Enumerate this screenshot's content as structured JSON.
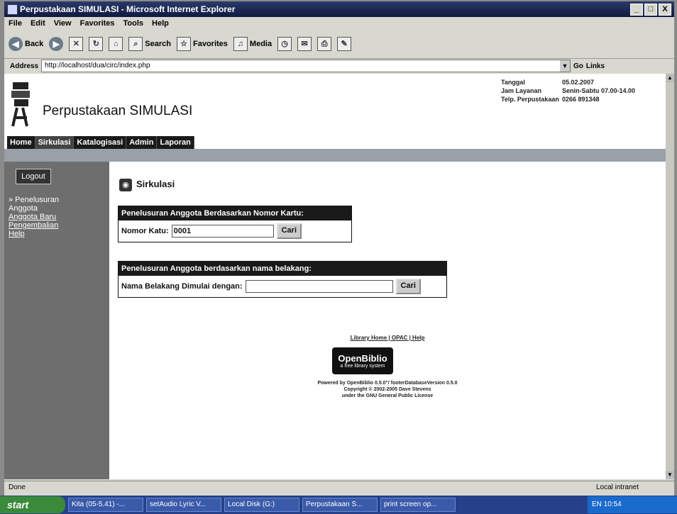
{
  "window": {
    "title": "Perpustakaan SIMULASI - Microsoft Internet Explorer",
    "buttons": [
      "_",
      "□",
      "X"
    ]
  },
  "menubar": [
    "File",
    "Edit",
    "View",
    "Favorites",
    "Tools",
    "Help"
  ],
  "toolbar": {
    "back": "Back",
    "search": "Search",
    "favorites": "Favorites",
    "media": "Media"
  },
  "address": {
    "label": "Address",
    "url": "http://localhost/dua/circ/index.php",
    "go": "Go",
    "links": "Links"
  },
  "header": {
    "site_title": "Perpustakaan SIMULASI",
    "info": [
      {
        "k": "Tanggal",
        "v": "05.02.2007"
      },
      {
        "k": "Jam Layanan",
        "v": "Senin-Sabtu 07.00-14.00"
      },
      {
        "k": "Telp. Perpustakaan",
        "v": "0266 891348"
      }
    ]
  },
  "tabs": [
    {
      "label": "Home"
    },
    {
      "label": "Sirkulasi"
    },
    {
      "label": "Katalogisasi"
    },
    {
      "label": "Admin"
    },
    {
      "label": "Laporan"
    }
  ],
  "sidebar": {
    "logout": "Logout",
    "items": [
      "» Penelusuran Anggota",
      "Anggota Baru",
      "Pengembalian",
      "Help"
    ]
  },
  "main": {
    "title": "Sirkulasi",
    "card_search": {
      "header": "Penelusuran Anggota Berdasarkan Nomor Kartu:",
      "label": "Nomor Katu:",
      "value": "0001",
      "button": "Cari"
    },
    "name_search": {
      "header": "Penelusuran Anggota berdasarkan nama belakang:",
      "label": "Nama Belakang Dimulai dengan:",
      "value": "",
      "button": "Cari"
    }
  },
  "footer": {
    "links": "Library Home | OPAC | Help",
    "logo_title": "OpenBiblio",
    "logo_sub": "a free library system",
    "powered": "Powered by OpenBiblio 0.5.0\"/ footerDatabaseVersion 0.5.0",
    "copyright": "Copyright © 2002-2005 Dave Stevens",
    "license": "under the GNU General Public License"
  },
  "statusbar": {
    "left": "Done",
    "zone": "Local intranet"
  },
  "taskbar": {
    "start": "start",
    "tasks": [
      "Kita (05-5.41) -...",
      "setAudio Lyric V...",
      "Local Disk (G:)",
      "Perpustakaan S...",
      "print screen op..."
    ],
    "tray": "EN  10:54"
  }
}
